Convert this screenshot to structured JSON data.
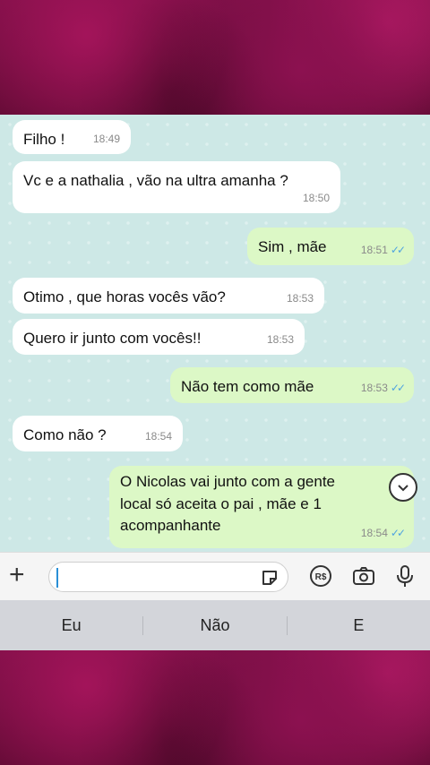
{
  "messages": [
    {
      "dir": "in",
      "text": "Filho !",
      "time": "18:49"
    },
    {
      "dir": "in",
      "text": "Vc e a nathalia , vão na ultra amanha ?",
      "time": "18:50"
    },
    {
      "dir": "out",
      "text": "Sim , mãe",
      "time": "18:51"
    },
    {
      "dir": "in",
      "text": "Otimo , que horas vocês vão?",
      "time": "18:53"
    },
    {
      "dir": "in",
      "text": "Quero ir junto com vocês!!",
      "time": "18:53"
    },
    {
      "dir": "out",
      "text": "Não tem como mãe",
      "time": "18:53"
    },
    {
      "dir": "in",
      "text": "Como não ?",
      "time": "18:54"
    },
    {
      "dir": "out",
      "text_lines": [
        "O Nicolas vai junto com a gente",
        "local só aceita o pai , mãe e 1",
        "acompanhante"
      ],
      "time": "18:54"
    }
  ],
  "ticks": "✓✓",
  "icons": {
    "plus": "plus-icon",
    "sticker": "sticker-icon",
    "payment": "payment-icon",
    "camera": "camera-icon",
    "mic": "microphone-icon",
    "scroll": "chevron-down-icon"
  },
  "payment_label": "R$",
  "keyboard": {
    "suggestions": [
      "Eu",
      "Não",
      "E"
    ]
  },
  "colors": {
    "incoming": "#ffffff",
    "outgoing": "#dcf8c6",
    "chat_bg": "#cde8e6",
    "ticks": "#4fa3e0",
    "frame": "#7a0f45"
  }
}
